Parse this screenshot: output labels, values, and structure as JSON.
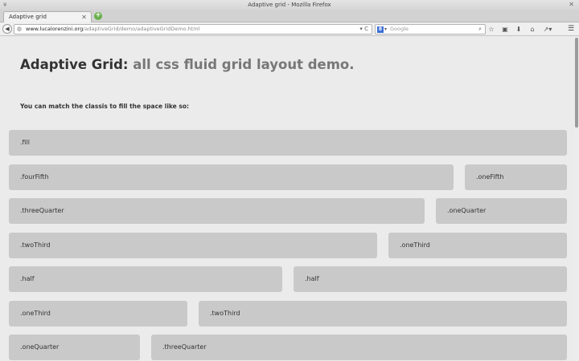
{
  "window": {
    "title": "Adaptive grid - Mozilla Firefox",
    "wm_left_glyph": "¥",
    "close_glyph": "✕"
  },
  "tabs": [
    {
      "label": "Adaptive grid",
      "close_glyph": "✕"
    }
  ],
  "new_tab_glyph": "+",
  "nav": {
    "back_glyph": "◀",
    "url_domain": "www.lucalorenzini.org",
    "url_path": "/adaptiveGrid/demo/adaptiveGridDemo.html",
    "url_tools": "▾ C",
    "search_engine_letter": "8",
    "search_engine_arrow": "▾",
    "search_placeholder": "Google",
    "search_glass": "⌕",
    "toolbar_icons": [
      {
        "name": "star-icon",
        "glyph": "☆"
      },
      {
        "name": "clipboard-icon",
        "glyph": "▣"
      },
      {
        "name": "download-icon",
        "glyph": "⬇"
      },
      {
        "name": "home-icon",
        "glyph": "⌂"
      },
      {
        "name": "share-icon",
        "glyph": "↗▾"
      }
    ],
    "menu_glyph": "☰"
  },
  "page": {
    "title_main": "Adaptive Grid:",
    "title_sub": " all css fluid grid layout demo.",
    "intro": "You can match the classis to fill the space like so:",
    "rows": [
      {
        "cells": [
          ".fill"
        ]
      },
      {
        "cells": [
          ".fourFifth",
          ".oneFifth"
        ]
      },
      {
        "cells": [
          ".threeQuarter",
          ".oneQuarter"
        ]
      },
      {
        "cells": [
          ".twoThird",
          ".oneThird"
        ]
      },
      {
        "cells": [
          ".half",
          ".half"
        ]
      },
      {
        "cells": [
          ".oneThird",
          ".twoThird"
        ]
      },
      {
        "cells": [
          ".oneQuarter",
          ".threeQuarter"
        ]
      }
    ]
  },
  "colors": {
    "background": "#ebebeb",
    "cell": "#c9c9c9",
    "title": "#333333",
    "title_sub": "#777777"
  }
}
